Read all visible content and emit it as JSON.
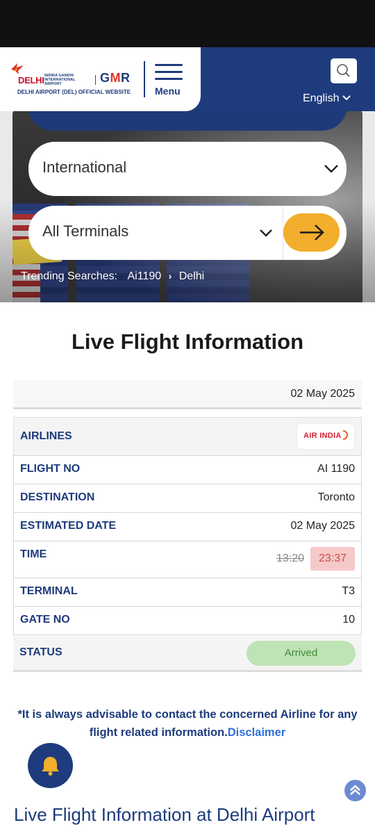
{
  "header": {
    "logo_delhi": "DELHI",
    "logo_igia": "INDIRA GANDHI INTERNATIONAL AIRPORT",
    "logo_gmr": "GMR",
    "logo_subtitle": "DELHI AIRPORT (DEL) OFFICIAL WEBSITE",
    "menu_label": "Menu",
    "language": "English"
  },
  "search": {
    "flight_type": "International",
    "terminal": "All Terminals",
    "trending_label": "Trending Searches:",
    "trending_items": [
      "Ai1190",
      "Delhi"
    ]
  },
  "page_title": "Live Flight Information",
  "flight": {
    "date": "02 May 2025",
    "airline_logo_text": "AIR INDIA",
    "rows": {
      "airlines": {
        "label": "AIRLINES"
      },
      "flight_no": {
        "label": "FLIGHT NO",
        "value": "AI 1190"
      },
      "destination": {
        "label": "DESTINATION",
        "value": "Toronto"
      },
      "estimated_date": {
        "label": "ESTIMATED DATE",
        "value": "02 May 2025"
      },
      "time": {
        "label": "TIME",
        "scheduled": "13:20",
        "estimated": "23:37"
      },
      "terminal": {
        "label": "TERMINAL",
        "value": "T3"
      },
      "gate": {
        "label": "GATE NO",
        "value": "10"
      },
      "status": {
        "label": "STATUS",
        "value": "Arrived"
      }
    }
  },
  "advisory": {
    "text": "*It is always advisable to contact the concerned Airline for any flight related information.",
    "link": "Disclaimer"
  },
  "footer_heading": "Live Flight Information at Delhi Airport",
  "colors": {
    "brand_navy": "#1e3b7d",
    "accent_orange": "#f2ae2c",
    "delayed_red_bg": "#f6c9c9",
    "arrived_green_bg": "#bfe3b4",
    "link_blue": "#2d6fd6"
  },
  "icons": [
    "search-icon",
    "chevron-down-icon",
    "arrow-right-icon",
    "chevron-right-icon",
    "bell-icon",
    "chevron-up-icon",
    "hamburger-icon"
  ]
}
